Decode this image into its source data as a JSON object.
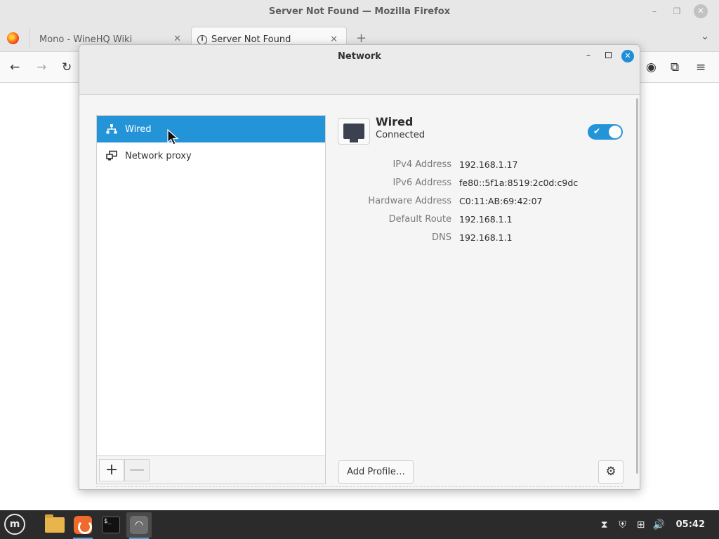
{
  "browser": {
    "window_title": "Server Not Found — Mozilla Firefox",
    "tabs": [
      {
        "label": "Mono - WineHQ Wiki"
      },
      {
        "label": "Server Not Found"
      }
    ]
  },
  "dialog": {
    "title": "Network",
    "sidebar": {
      "items": [
        {
          "label": "Wired",
          "icon": "wired-network-icon",
          "selected": true
        },
        {
          "label": "Network proxy",
          "icon": "network-proxy-icon",
          "selected": false
        }
      ],
      "add_symbol": "+",
      "remove_symbol": "—"
    },
    "device": {
      "name": "Wired",
      "status": "Connected",
      "enabled": true,
      "properties": [
        {
          "label": "IPv4 Address",
          "value": "192.168.1.17"
        },
        {
          "label": "IPv6 Address",
          "value": "fe80::5f1a:8519:2c0d:c9dc"
        },
        {
          "label": "Hardware Address",
          "value": "C0:11:AB:69:42:07"
        },
        {
          "label": "Default Route",
          "value": "192.168.1.1"
        },
        {
          "label": "DNS",
          "value": "192.168.1.1"
        }
      ]
    },
    "add_profile_label": "Add Profile…"
  },
  "taskbar": {
    "clock": "05:42",
    "apps": [
      "file-manager-icon",
      "firefox-icon",
      "terminal-icon",
      "network-settings-icon"
    ]
  },
  "colors": {
    "accent": "#2494d9",
    "close_button": "#1e8fd6",
    "taskbar": "#2b2b2b"
  }
}
